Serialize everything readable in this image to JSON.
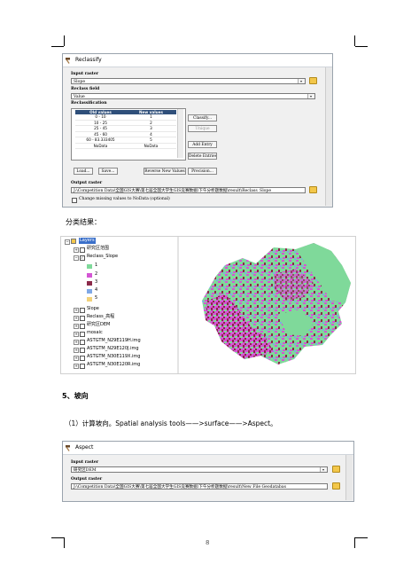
{
  "reclassify": {
    "title": "Reclassify",
    "input_raster_label": "Input raster",
    "input_raster_value": "Slope",
    "reclass_field_label": "Reclass field",
    "reclass_field_value": "Value",
    "reclassification_label": "Reclassification",
    "table_headers": [
      "Old values",
      "New values"
    ],
    "rows": [
      [
        "0 - 10",
        "1"
      ],
      [
        "10 - 25",
        "2"
      ],
      [
        "25 - 45",
        "3"
      ],
      [
        "45 - 60",
        "4"
      ],
      [
        "60 - 83.333405",
        "5"
      ],
      [
        "NoData",
        "NoData"
      ]
    ],
    "side_buttons": [
      "Classify...",
      "Unique",
      "Add Entry",
      "Delete Entries"
    ],
    "bottom_buttons": [
      "Load...",
      "Save...",
      "Reverse New Values",
      "Precision..."
    ],
    "output_raster_label": "Output raster",
    "output_raster_value": "J:\\Competition Data\\全国GIS大赛\\第七届全国大学生GIS竞赛数据\\下午分析题数据\\result\\Reclass_Slope",
    "nodata_checkbox_label": "Change missing values to NoData (optional)"
  },
  "text": {
    "classification_result": "分类结果：",
    "section_heading": "5、坡向",
    "step_text": "（1）计算坡向。Spatial analysis tools——>surface——>Aspect。"
  },
  "toc": {
    "root": "Layers",
    "items": [
      {
        "label": "研究区范围",
        "level": 1,
        "expand": "+",
        "checked": false
      },
      {
        "label": "Reclass_Slope",
        "level": 1,
        "expand": "-",
        "checked": true
      },
      {
        "label": "Slope",
        "level": 1,
        "expand": "+",
        "checked": false
      },
      {
        "label": "Reclass_高程",
        "level": 1,
        "expand": "+",
        "checked": false
      },
      {
        "label": "研究区DEM",
        "level": 1,
        "expand": "+",
        "checked": false
      },
      {
        "label": "mosaic",
        "level": 1,
        "expand": "+",
        "checked": false
      },
      {
        "label": "ASTGTM_N29E119H.img",
        "level": 1,
        "expand": "+",
        "checked": false
      },
      {
        "label": "ASTGTM_N29E120J.img",
        "level": 1,
        "expand": "+",
        "checked": false
      },
      {
        "label": "ASTGTM_N30E119X.img",
        "level": 1,
        "expand": "+",
        "checked": false
      },
      {
        "label": "ASTGTM_N30E120R.img",
        "level": 1,
        "expand": "+",
        "checked": false
      }
    ],
    "legend": [
      {
        "label": "1",
        "color": "#7fd99a"
      },
      {
        "label": "2",
        "color": "#d455d4"
      },
      {
        "label": "3",
        "color": "#8b2a4a"
      },
      {
        "label": "4",
        "color": "#7fa8e6"
      },
      {
        "label": "5",
        "color": "#f2d27a"
      }
    ]
  },
  "aspect": {
    "title": "Aspect",
    "input_raster_label": "Input raster",
    "input_raster_value": "研究区DEM",
    "output_raster_label": "Output raster",
    "output_raster_value": "J:\\Competition Data\\全国GIS大赛\\第七届全国大学生GIS竞赛数据\\下午分析题数据\\result\\New File Geodatabas"
  },
  "page_number": "8"
}
